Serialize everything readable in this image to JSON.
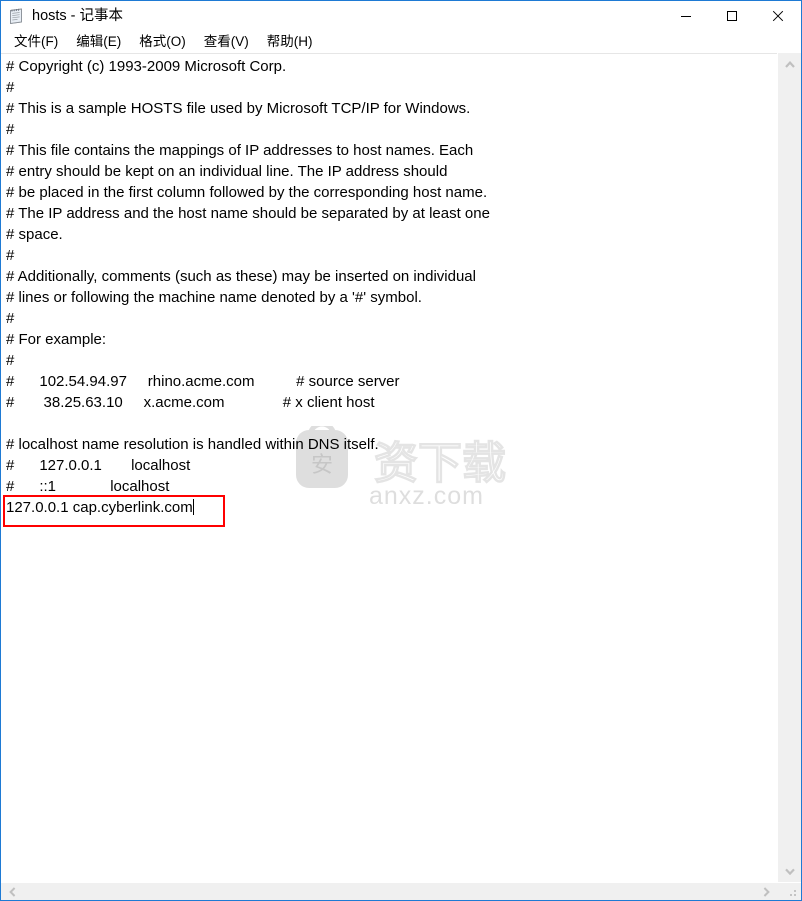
{
  "window": {
    "title": "hosts - 记事本",
    "icon": "notepad-icon",
    "border_color": "#1e7ad4",
    "controls": {
      "minimize": "minimize-icon",
      "maximize": "maximize-icon",
      "close": "close-icon"
    }
  },
  "menu": {
    "items": [
      {
        "label": "文件(F)"
      },
      {
        "label": "编辑(E)"
      },
      {
        "label": "格式(O)"
      },
      {
        "label": "查看(V)"
      },
      {
        "label": "帮助(H)"
      }
    ]
  },
  "editor": {
    "lines": [
      "# Copyright (c) 1993-2009 Microsoft Corp.",
      "#",
      "# This is a sample HOSTS file used by Microsoft TCP/IP for Windows.",
      "#",
      "# This file contains the mappings of IP addresses to host names. Each",
      "# entry should be kept on an individual line. The IP address should",
      "# be placed in the first column followed by the corresponding host name.",
      "# The IP address and the host name should be separated by at least one",
      "# space.",
      "#",
      "# Additionally, comments (such as these) may be inserted on individual",
      "# lines or following the machine name denoted by a '#' symbol.",
      "#",
      "# For example:",
      "#",
      "#      102.54.94.97     rhino.acme.com          # source server",
      "#       38.25.63.10     x.acme.com              # x client host",
      "",
      "# localhost name resolution is handled within DNS itself.",
      "#\t127.0.0.1       localhost",
      "#\t::1             localhost"
    ],
    "active_line": "127.0.0.1 cap.cyberlink.com",
    "caret_visible": true
  },
  "annotation": {
    "color": "#ff0000",
    "target_text": "127.0.0.1 cap.cyberlink.com"
  },
  "watermark": {
    "text": "anxz.com",
    "badge_char": "安",
    "outline_text": "资下载",
    "color": "#d9d9d9"
  },
  "scrollbars": {
    "vertical": {
      "up_arrow": "chevron-up-icon",
      "down_arrow": "chevron-down-icon",
      "track_color": "#f0f0f0"
    },
    "horizontal": {
      "left_arrow": "chevron-left-icon",
      "right_arrow": "chevron-right-icon",
      "track_color": "#f0f0f0"
    },
    "resize_grip": "resize-grip-icon"
  }
}
